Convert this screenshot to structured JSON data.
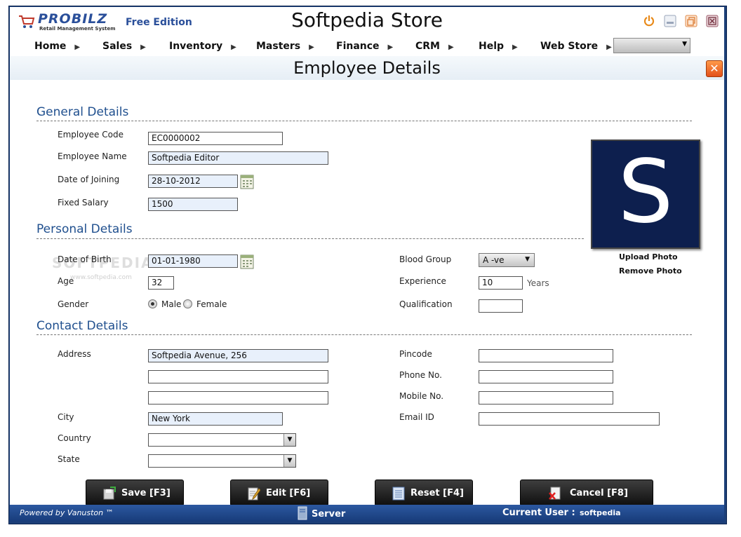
{
  "titlebar": {
    "logo_text": "PROBILZ",
    "logo_sub": "Retail Management System",
    "edition": "Free Edition",
    "store_title": "Softpedia Store"
  },
  "menu": {
    "items": [
      "Home",
      "Sales",
      "Inventory",
      "Masters",
      "Finance",
      "CRM",
      "Help",
      "Web Store"
    ],
    "select_value": ""
  },
  "page": {
    "title": "Employee Details"
  },
  "general": {
    "heading": "General Details",
    "employee_code_label": "Employee  Code",
    "employee_code": "EC0000002",
    "employee_name_label": "Employee Name",
    "employee_name": "Softpedia Editor",
    "date_of_joining_label": "Date of Joining",
    "date_of_joining": "28-10-2012",
    "fixed_salary_label": "Fixed Salary",
    "fixed_salary": "1500"
  },
  "personal": {
    "heading": "Personal Details",
    "dob_label": "Date of Birth",
    "dob": "01-01-1980",
    "age_label": "Age",
    "age": "32",
    "gender_label": "Gender",
    "gender_male": "Male",
    "gender_female": "Female",
    "blood_group_label": "Blood Group",
    "blood_group": "A -ve",
    "experience_label": "Experience",
    "experience": "10",
    "experience_unit": "Years",
    "qualification_label": "Qualification",
    "qualification": ""
  },
  "photo": {
    "upload": "Upload Photo",
    "remove": "Remove Photo",
    "letter": "S"
  },
  "contact": {
    "heading": "Contact Details",
    "address_label": "Address",
    "address1": "Softpedia Avenue, 256",
    "address2": "",
    "address3": "",
    "city_label": "City",
    "city": "New York",
    "country_label": "Country",
    "country": "",
    "state_label": "State",
    "state": "",
    "pincode_label": "Pincode",
    "pincode": "",
    "phone_label": "Phone No.",
    "phone": "",
    "mobile_label": "Mobile No.",
    "mobile": "",
    "email_label": "Email ID",
    "email": ""
  },
  "buttons": {
    "save": "Save [F3]",
    "edit": "Edit [F6]",
    "reset": "Reset [F4]",
    "cancel": "Cancel [F8]"
  },
  "status": {
    "powered_by": "Powered by Vanuston ™",
    "server": "Server",
    "current_user_label": "Current User :",
    "current_user": "softpedia"
  },
  "watermark": {
    "text": "SOFTPEDIA",
    "url": "www.softpedia.com"
  },
  "colors": {
    "accent": "#1f4f8e",
    "status_bar": "#1c3f78",
    "close": "#e3501a"
  }
}
